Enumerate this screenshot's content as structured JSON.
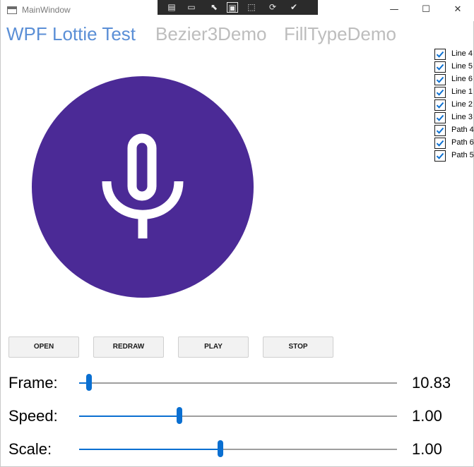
{
  "window": {
    "title": "MainWindow"
  },
  "devtools": {
    "icons": [
      "live-visual-tree-icon",
      "record-icon",
      "select-element-icon",
      "display-layout-adorners-icon",
      "track-focus-icon",
      "hot-reload-icon",
      "checkmark-circle-icon"
    ],
    "glyphs": [
      "▤",
      "▭",
      "⬉",
      "▣",
      "⬚",
      "⟳",
      "✔"
    ]
  },
  "window_controls": {
    "minimize": "—",
    "maximize": "☐",
    "close": "✕"
  },
  "tabs": [
    {
      "label": "WPF Lottie Test",
      "active": true
    },
    {
      "label": "Bezier3Demo",
      "active": false
    },
    {
      "label": "FillTypeDemo",
      "active": false
    }
  ],
  "layers": [
    {
      "label": "Line 4",
      "checked": true
    },
    {
      "label": "Line 5",
      "checked": true
    },
    {
      "label": "Line 6",
      "checked": true
    },
    {
      "label": "Line 1",
      "checked": true
    },
    {
      "label": "Line 2",
      "checked": true
    },
    {
      "label": "Line 3",
      "checked": true
    },
    {
      "label": "Path 4",
      "checked": true
    },
    {
      "label": "Path 6",
      "checked": true
    },
    {
      "label": "Path 5",
      "checked": true
    }
  ],
  "animation": {
    "icon": "microphone-icon",
    "circle_color": "#4b2a96",
    "glyph_color": "#ffffff"
  },
  "buttons": {
    "open": "OPEN",
    "redraw": "REDRAW",
    "play": "PLAY",
    "stop": "STOP"
  },
  "sliders": {
    "frame": {
      "label": "Frame:",
      "value": "10.83",
      "position_fraction": 0.03
    },
    "speed": {
      "label": "Speed:",
      "value": "1.00",
      "position_fraction": 0.315
    },
    "scale": {
      "label": "Scale:",
      "value": "1.00",
      "position_fraction": 0.445
    }
  },
  "colors": {
    "accent": "#0a6fd1",
    "active_tab": "#5b8fd6",
    "inactive_tab": "#bdbdbd"
  }
}
